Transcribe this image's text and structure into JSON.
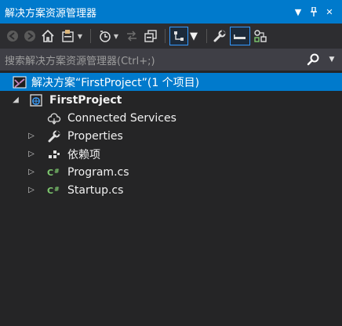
{
  "title_bar": {
    "title": "解决方案资源管理器",
    "dropdown_icon": "▼",
    "pin_icon": "ᚿ",
    "close_icon": "✕"
  },
  "toolbar": {
    "buttons": [
      "back",
      "forward",
      "home",
      "switch-views",
      "pending-changes-filter",
      "sync-with-active-document",
      "collapse-all",
      "show-all-files",
      "properties",
      "preview-selected-items",
      "map-code"
    ]
  },
  "search": {
    "placeholder": "搜索解决方案资源管理器(Ctrl+;)"
  },
  "tree": {
    "solution": "解决方案“FirstProject”(1 个项目)",
    "project": "FirstProject",
    "items": [
      {
        "label": "Connected Services",
        "icon": "connected-services"
      },
      {
        "label": "Properties",
        "icon": "wrench"
      },
      {
        "label": "依赖项",
        "icon": "dependencies"
      },
      {
        "label": "Program.cs",
        "icon": "csharp-file"
      },
      {
        "label": "Startup.cs",
        "icon": "csharp-file"
      }
    ]
  },
  "colors": {
    "accent": "#007acc",
    "background": "#252526",
    "toolbar": "#2d2d30",
    "search": "#3f3f46",
    "csharp": "#7ec96f"
  }
}
